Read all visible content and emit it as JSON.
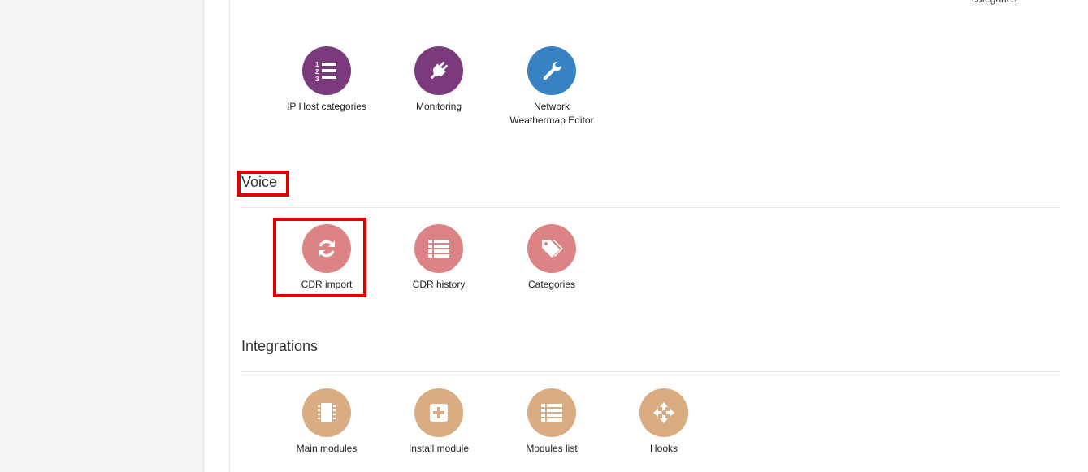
{
  "top_cutoff_label": "categories",
  "colors": {
    "purple": "#7b3a7c",
    "blue": "#3881c2",
    "pink": "#db8385",
    "tan": "#d9ac82",
    "highlight": "#e00000"
  },
  "monitoring_tiles": [
    {
      "label": "IP Host categories",
      "icon": "ordered-list-icon",
      "color": "#7b3a7c"
    },
    {
      "label": "Monitoring",
      "icon": "plug-icon",
      "color": "#7b3a7c"
    },
    {
      "label_line1": "Network",
      "label_line2": "Weathermap Editor",
      "icon": "wrench-icon",
      "color": "#3881c2"
    }
  ],
  "voice": {
    "title": "Voice",
    "tiles": [
      {
        "label": "CDR import",
        "icon": "refresh-icon",
        "color": "#db8385"
      },
      {
        "label": "CDR history",
        "icon": "list-icon",
        "color": "#db8385"
      },
      {
        "label": "Categories",
        "icon": "tags-icon",
        "color": "#db8385"
      }
    ]
  },
  "integrations": {
    "title": "Integrations",
    "tiles": [
      {
        "label": "Main modules",
        "icon": "chip-icon",
        "color": "#d9ac82"
      },
      {
        "label": "Install module",
        "icon": "plus-square-icon",
        "color": "#d9ac82"
      },
      {
        "label": "Modules list",
        "icon": "list-icon",
        "color": "#d9ac82"
      },
      {
        "label": "Hooks",
        "icon": "arrows-icon",
        "color": "#d9ac82"
      }
    ]
  }
}
